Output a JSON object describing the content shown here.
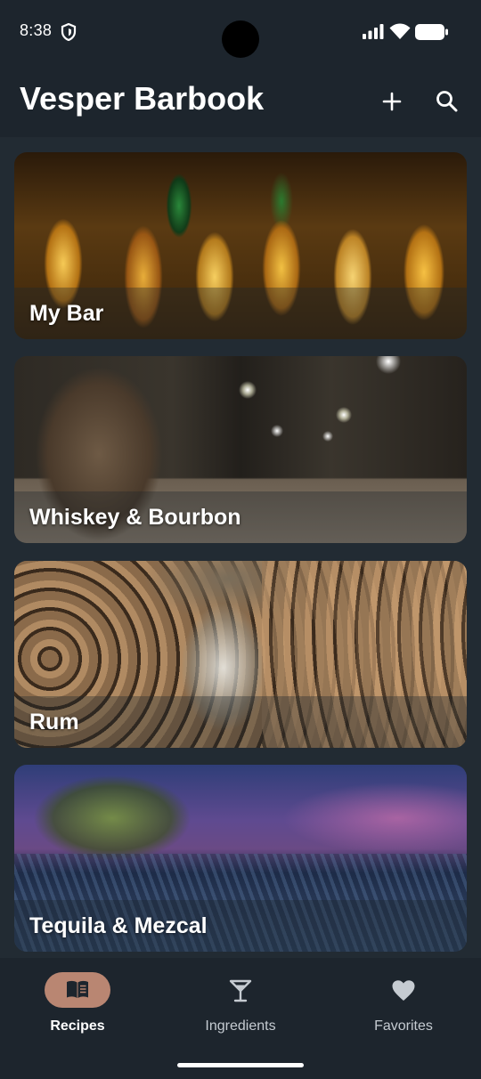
{
  "status_bar": {
    "time": "8:38",
    "icons": [
      "shield-icon",
      "signal-icon",
      "wifi-icon",
      "battery-icon"
    ]
  },
  "app_bar": {
    "title": "Vesper Barbook",
    "actions": [
      "add-icon",
      "search-icon"
    ]
  },
  "categories": [
    {
      "title": "My Bar"
    },
    {
      "title": "Whiskey & Bourbon"
    },
    {
      "title": "Rum"
    },
    {
      "title": "Tequila & Mezcal"
    }
  ],
  "bottom_nav": {
    "items": [
      {
        "label": "Recipes",
        "icon": "book-icon",
        "active": true
      },
      {
        "label": "Ingredients",
        "icon": "cocktail-glass-icon",
        "active": false
      },
      {
        "label": "Favorites",
        "icon": "heart-icon",
        "active": false
      }
    ]
  },
  "colors": {
    "background": "#1d252d",
    "content_background": "#222b33",
    "active_pill": "#b98672",
    "text": "#ffffff"
  }
}
